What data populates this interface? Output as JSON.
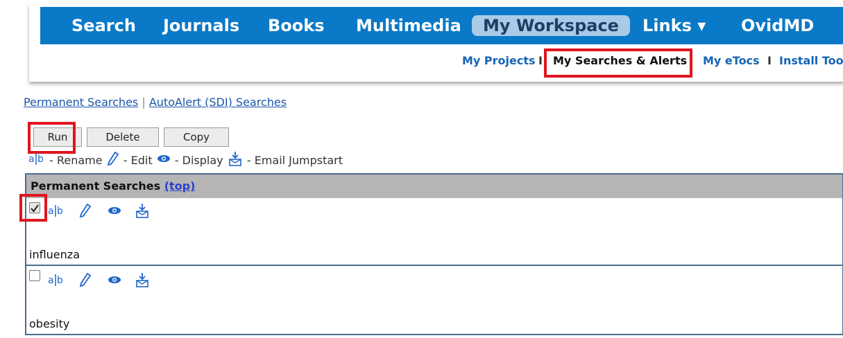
{
  "nav": {
    "items": [
      {
        "label": "Search"
      },
      {
        "label": "Journals"
      },
      {
        "label": "Books"
      },
      {
        "label": "Multimedia"
      },
      {
        "label": "My Workspace",
        "active": true
      },
      {
        "label": "Links ▾"
      },
      {
        "label": "OvidMD"
      }
    ],
    "bg_color": "#0a79c7",
    "active_bg_color": "#a9cbe8"
  },
  "subnav": {
    "items": [
      {
        "label": "My Projects"
      },
      {
        "label": "My Searches & Alerts",
        "selected": true
      },
      {
        "label": "My eTocs"
      },
      {
        "label": "Install Too"
      }
    ],
    "separator": "I"
  },
  "search_tabs": {
    "permanent": "Permanent Searches",
    "separator": "|",
    "autoalert": "AutoAlert (SDI) Searches"
  },
  "buttons": {
    "run": "Run",
    "delete": "Delete",
    "copy": "Copy"
  },
  "legend": {
    "rename_icon": "a|b",
    "rename": "- Rename",
    "edit": "- Edit",
    "display": "- Display",
    "email": "- Email Jumpstart"
  },
  "panel": {
    "title": "Permanent Searches",
    "top_link": "(top)",
    "rows": [
      {
        "name": "influenza",
        "checked": true
      },
      {
        "name": "obesity",
        "checked": false
      }
    ]
  },
  "highlight_color": "#e0141e"
}
